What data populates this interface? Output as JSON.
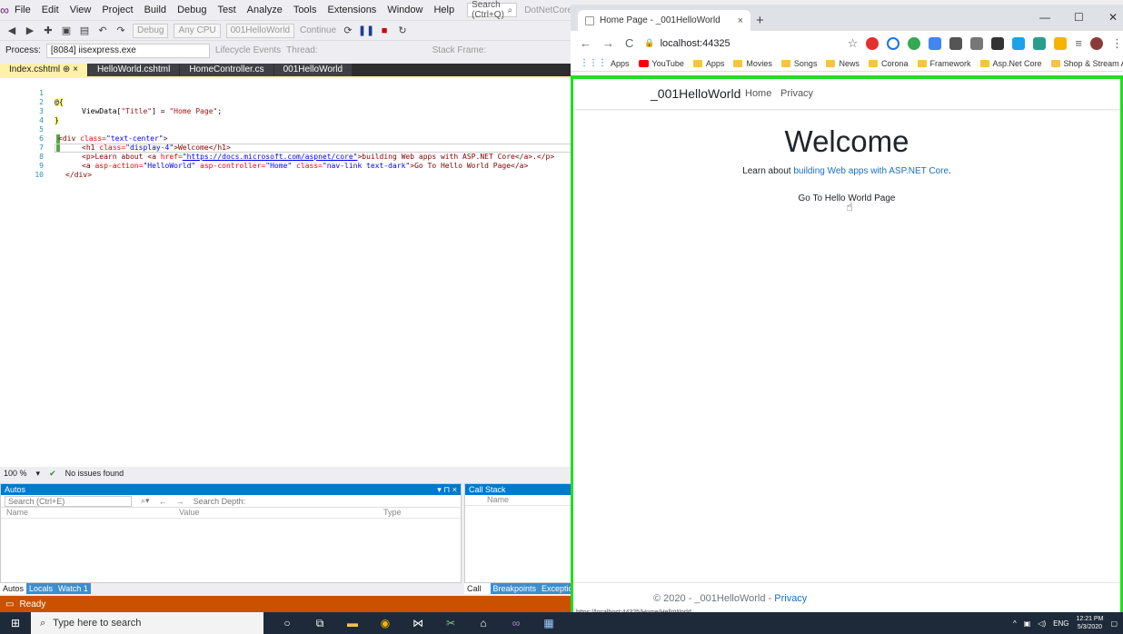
{
  "vs": {
    "menu": [
      "File",
      "Edit",
      "View",
      "Project",
      "Build",
      "Debug",
      "Test",
      "Analyze",
      "Tools",
      "Extensions",
      "Window",
      "Help"
    ],
    "search_placeholder": "Search (Ctrl+Q)",
    "solution_name": "DotNetCore",
    "toolbar1": {
      "config": "Debug",
      "platform": "Any CPU",
      "project": "001HelloWorld",
      "continue": "Continue"
    },
    "toolbar2": {
      "process_label": "Process:",
      "process_value": "[8084] iisexpress.exe",
      "lifecycle": "Lifecycle Events",
      "thread_label": "Thread:",
      "stack_frame": "Stack Frame:"
    },
    "tabs": [
      {
        "label": "Index.cshtml",
        "pin": "⊕",
        "close": "×"
      },
      {
        "label": "HelloWorld.cshtml"
      },
      {
        "label": "HomeController.cs"
      },
      {
        "label": "001HelloWorld"
      }
    ],
    "code_lines": [
      "1",
      "2",
      "3",
      "4",
      "5",
      "6",
      "7",
      "8",
      "9",
      "10"
    ],
    "code": {
      "l1": "@{",
      "l2_a": "ViewData[",
      "l2_b": "\"Title\"",
      "l2_c": "] = ",
      "l2_d": "\"Home Page\"",
      "l2_e": ";",
      "l3": "}",
      "l5_a": "<div ",
      "l5_b": "class=",
      "l5_c": "\"text-center\"",
      "l5_d": ">",
      "l6_a": "<h1 ",
      "l6_b": "class=",
      "l6_c": "\"display-4\"",
      "l6_d": ">Welcome</h1>",
      "l7_a": "<p>Learn about <a ",
      "l7_b": "href=",
      "l7_c": "\"https://docs.microsoft.com/aspnet/core\"",
      "l7_d": ">building Web apps with ASP.NET Core</a>.</p>",
      "l8_a": "<a ",
      "l8_b": "asp-action=",
      "l8_c": "\"HelloWorld\"",
      "l8_d": " asp-controller=",
      "l8_e": "\"Home\"",
      "l8_f": " class=",
      "l8_g": "\"nav-link text-dark\"",
      "l8_h": ">Go To Hello World Page</a>",
      "l9": "</div>"
    },
    "zoom": "100 %",
    "issues": "No issues found",
    "autos": {
      "title": "Autos",
      "search": "Search (Ctrl+E)",
      "search_depth": "Search Depth:",
      "cols": [
        "Name",
        "Value",
        "Type"
      ]
    },
    "callstack": {
      "title": "Call Stack",
      "col": "Name"
    },
    "bottom_tabs_left": [
      "Autos",
      "Locals",
      "Watch 1"
    ],
    "bottom_tabs_right": [
      "Call Stack",
      "Breakpoints",
      "Exceptio"
    ],
    "status": "Ready"
  },
  "chrome": {
    "tab_title": "Home Page - _001HelloWorld",
    "url": "localhost:44325",
    "bookmarks": [
      "Apps",
      "YouTube",
      "Apps",
      "Movies",
      "Songs",
      "News",
      "Corona",
      "Framework",
      "Asp.Net Core",
      "Shop & Stream Apps"
    ],
    "more": "»"
  },
  "page": {
    "brand": "_001HelloWorld",
    "nav": [
      "Home",
      "Privacy"
    ],
    "heading": "Welcome",
    "learn_prefix": "Learn about ",
    "learn_link": "building Web apps with ASP.NET Core",
    "learn_suffix": ".",
    "hello_link": "Go To Hello World Page",
    "footer_prefix": "© 2020 - _001HelloWorld - ",
    "footer_link": "Privacy",
    "status_url": "https://localhost:44325/Home/HelloWorld"
  },
  "taskbar": {
    "search_placeholder": "Type here to search",
    "lang": "ENG",
    "time": "12:21 PM",
    "date": "5/3/2020"
  },
  "colors": {
    "vs_accent": "#007acc",
    "vs_status_debug": "#ca5100",
    "highlight_border": "#22dd22",
    "link": "#1b6ec2"
  }
}
